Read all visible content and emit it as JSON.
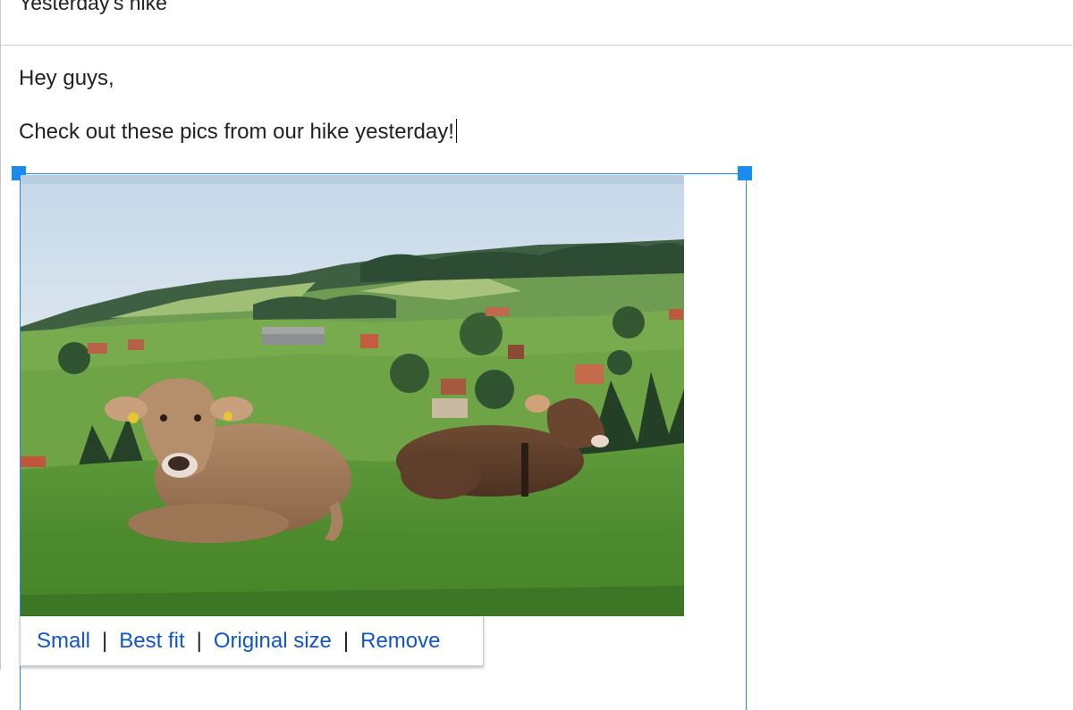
{
  "subject": "Yesterday's hike",
  "body": {
    "greeting": "Hey guys,",
    "message": "Check out these pics from our hike yesterday!"
  },
  "image": {
    "icon": "inline-photo-cows-on-hillside",
    "options": {
      "small": "Small",
      "best_fit": "Best fit",
      "original_size": "Original size",
      "remove": "Remove",
      "separator": "|"
    }
  },
  "colors": {
    "link": "#1155cc",
    "selection": "#2a8be6",
    "handle": "#1a8cf0"
  }
}
